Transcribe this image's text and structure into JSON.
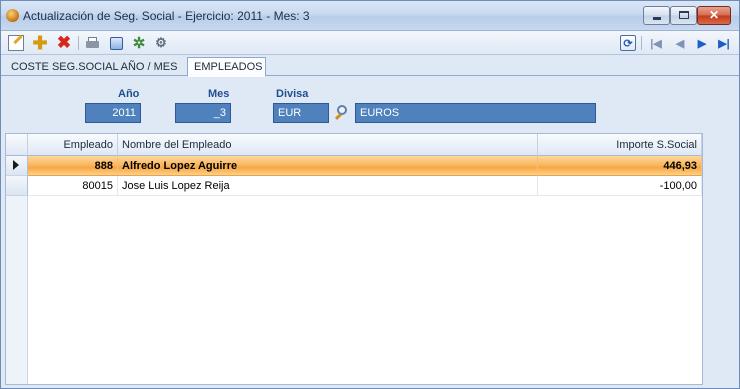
{
  "window": {
    "title": "Actualización de Seg. Social - Ejercicio: 2011 - Mes: 3",
    "app_icon": "app-logo-icon"
  },
  "window_controls": {
    "minimize_icon": "minimize-icon",
    "maximize_icon": "maximize-icon",
    "close_glyph": "✕"
  },
  "toolbar": {
    "icons": [
      "edit-icon",
      "add-icon",
      "delete-icon",
      "print-icon",
      "preview-icon",
      "settings-icon",
      "tools-icon",
      "refresh-icon",
      "first-record-icon",
      "previous-record-icon",
      "next-record-icon",
      "last-record-icon"
    ],
    "add_glyph": "✚",
    "delete_glyph": "✖",
    "settings_glyph": "✲",
    "tools_glyph": "⚙",
    "refresh_glyph": "⟳",
    "first_glyph": "|◀",
    "prev_glyph": "◀",
    "next_glyph": "▶",
    "last_glyph": "▶|"
  },
  "tabs": [
    {
      "label": "COSTE SEG.SOCIAL AÑO / MES",
      "active": false
    },
    {
      "label": "EMPLEADOS",
      "active": true
    }
  ],
  "form": {
    "year": {
      "label": "Año",
      "value": "2011"
    },
    "month": {
      "label": "Mes",
      "value": "_3"
    },
    "currency": {
      "label": "Divisa",
      "code": "EUR",
      "name": "EUROS"
    }
  },
  "grid": {
    "columns": [
      "Empleado",
      "Nombre del Empleado",
      "Importe S.Social"
    ],
    "rows": [
      {
        "empleado": "888",
        "nombre": "Alfredo Lopez Aguirre",
        "importe": "446,93",
        "selected": true
      },
      {
        "empleado": "80015",
        "nombre": "Jose Luis Lopez Reija",
        "importe": "-100,00",
        "selected": false
      }
    ]
  },
  "colors": {
    "accent": "#4f81bd",
    "selected_row": "#f9b45c",
    "label_blue": "#1f4f8f",
    "close_red": "#c2391c"
  }
}
